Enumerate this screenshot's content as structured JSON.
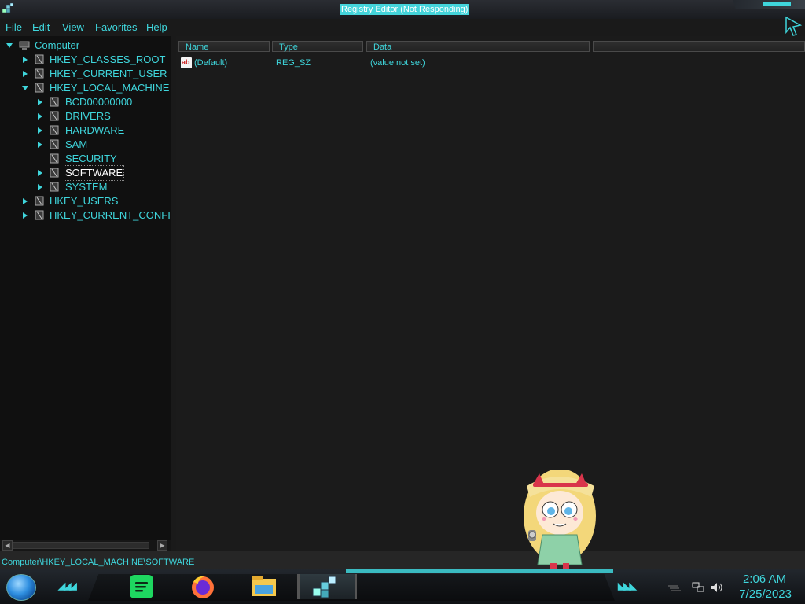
{
  "window": {
    "title": "Registry Editor (Not Responding)"
  },
  "menu": [
    "File",
    "Edit",
    "View",
    "Favorites",
    "Help"
  ],
  "tree": {
    "root": "Computer",
    "hives": [
      "HKEY_CLASSES_ROOT",
      "HKEY_CURRENT_USER",
      "HKEY_LOCAL_MACHINE",
      "HKEY_USERS",
      "HKEY_CURRENT_CONFI"
    ],
    "local_machine_children": [
      "BCD00000000",
      "DRIVERS",
      "HARDWARE",
      "SAM",
      "SECURITY",
      "SOFTWARE",
      "SYSTEM"
    ],
    "selected": "SOFTWARE"
  },
  "list": {
    "columns": [
      "Name",
      "Type",
      "Data"
    ],
    "rows": [
      {
        "name": "(Default)",
        "type": "REG_SZ",
        "data": "(value not set)"
      }
    ]
  },
  "status": {
    "path": "Computer\\HKEY_LOCAL_MACHINE\\SOFTWARE"
  },
  "taskbar": {
    "apps": [
      "spotify-icon",
      "firefox-icon",
      "file-explorer-icon",
      "registry-editor-icon"
    ],
    "clock": {
      "time": "2:06 AM",
      "date": "7/25/2023"
    }
  },
  "colors": {
    "accent": "#3fd6dc",
    "background": "#1b1b1b",
    "tree_background": "#101010"
  }
}
